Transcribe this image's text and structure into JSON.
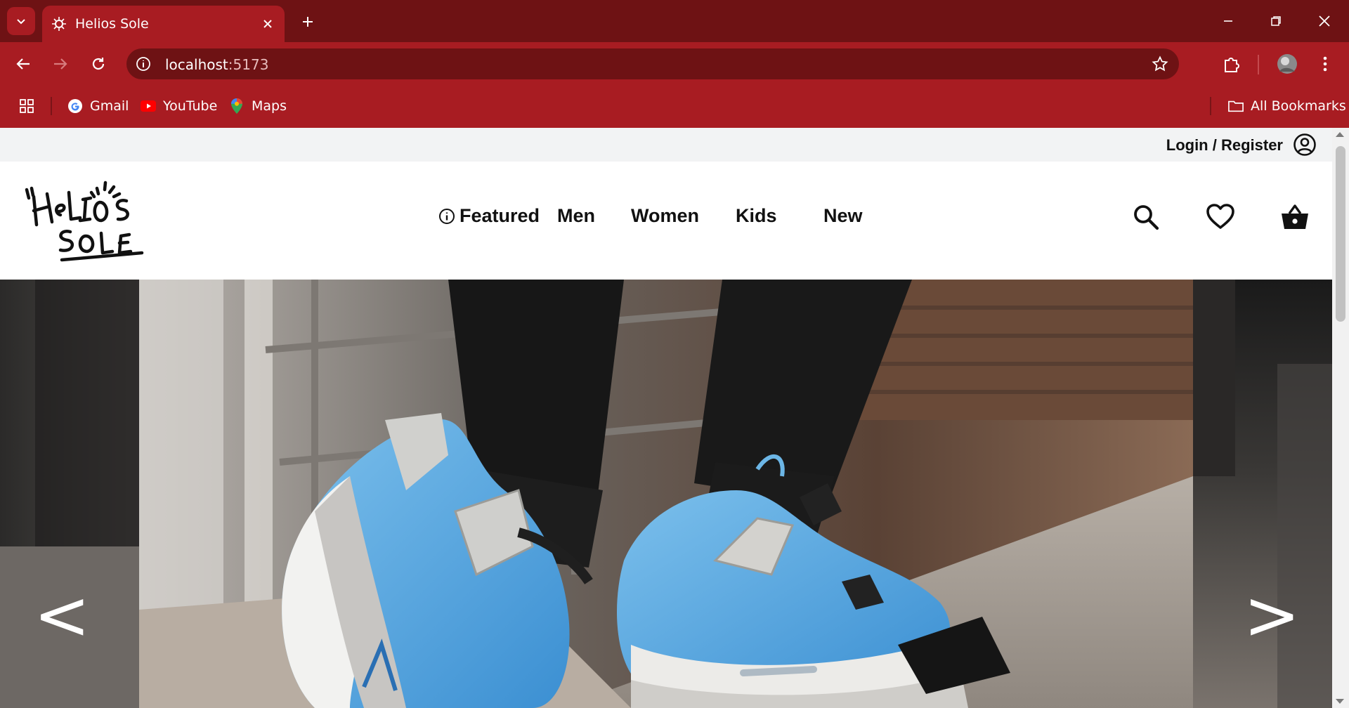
{
  "browser": {
    "tab_title": "Helios Sole",
    "url_host": "localhost",
    "url_port": ":5173",
    "bookmarks": [
      {
        "label": "Gmail",
        "icon": "gmail-icon"
      },
      {
        "label": "YouTube",
        "icon": "youtube-icon"
      },
      {
        "label": "Maps",
        "icon": "maps-icon"
      }
    ],
    "all_bookmarks": "All Bookmarks",
    "colors": {
      "tabstrip": "#6e1214",
      "toolbar": "#a81c22"
    }
  },
  "site": {
    "login_label": "Login / Register",
    "nav": [
      "Featured",
      "Men",
      "Women",
      "Kids",
      "New"
    ],
    "icons": [
      "search-icon",
      "heart-icon",
      "basket-icon",
      "user-circle-icon"
    ],
    "hero": {
      "prev": "<",
      "next": ">"
    },
    "logo_text": "Helios Sole"
  }
}
